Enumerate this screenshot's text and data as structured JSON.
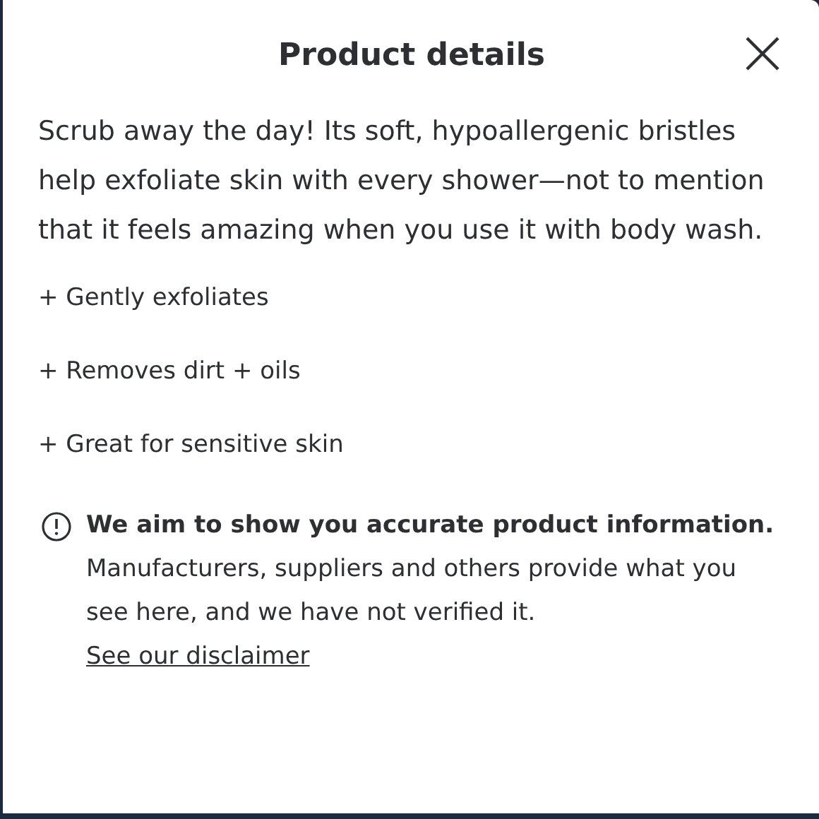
{
  "dialog": {
    "title": "Product details"
  },
  "description": "Scrub away the day! Its soft, hypoallergenic bristles help exfoliate skin with every shower—not to mention that it feels amazing when you use it with body wash.",
  "features": [
    "+ Gently exfoliates",
    "+ Removes dirt + oils",
    "+ Great for sensitive skin"
  ],
  "notice": {
    "heading": "We aim to show you accurate product information.",
    "text": "Manufacturers, suppliers and others provide what you see here, and we have not verified it.",
    "link": "See our disclaimer"
  }
}
